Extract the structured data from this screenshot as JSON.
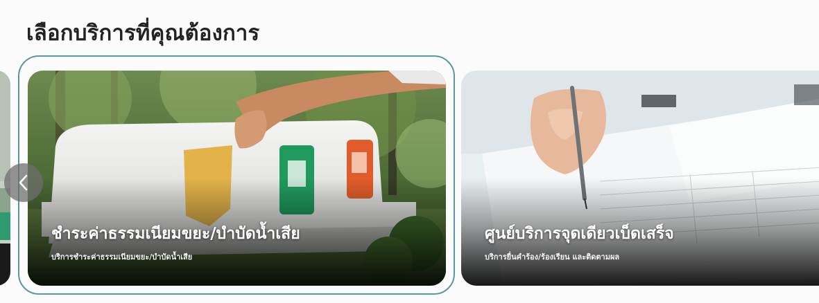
{
  "section": {
    "heading": "เลือกบริการที่คุณต้องการ"
  },
  "carousel": {
    "prev_icon": "chevron-left-icon",
    "cards": [
      {
        "title": "ชำระค่าธรรมเนียมขยะ/บำบัดน้ำเสีย",
        "subtitle": "บริการชำระค่าธรรมเนียมขยะ/บำบัดน้ำเสีย",
        "image": "recycling-bins-photo",
        "selected": true
      },
      {
        "title": "ศูนย์บริการจุดเดียวเบ็ดเสร็จ",
        "subtitle": "บริการยื่นคำร้อง/ร้องเรียน และติดตามผล",
        "image": "signing-document-photo",
        "selected": false
      }
    ]
  },
  "colors": {
    "focus_ring": "#5b94a3",
    "heading_text": "#222222",
    "card_text": "#ffffff"
  }
}
